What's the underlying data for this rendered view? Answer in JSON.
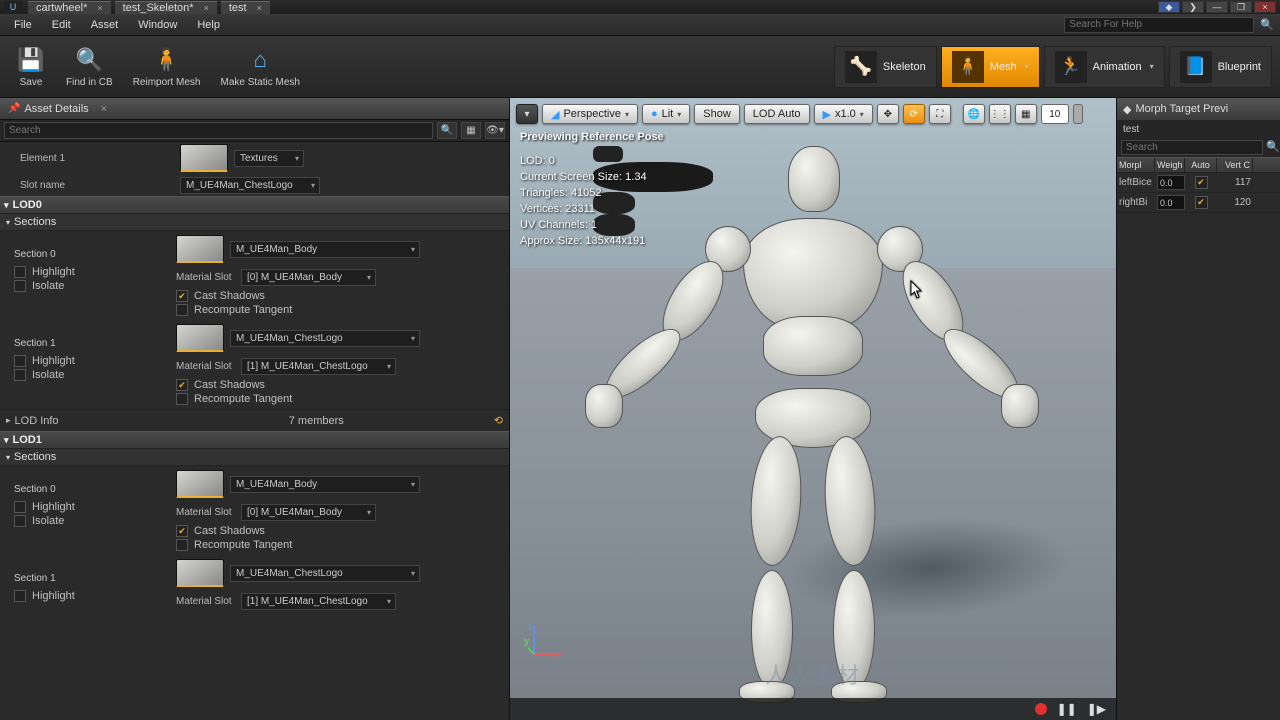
{
  "titlebar": {
    "tabs": [
      {
        "icon": "⬚",
        "label": "cartwheel*"
      },
      {
        "icon": "⬚",
        "label": "test_Skeleton*"
      },
      {
        "icon": "⬚",
        "label": "test"
      }
    ]
  },
  "menubar": {
    "items": [
      "File",
      "Edit",
      "Asset",
      "Window",
      "Help"
    ],
    "search_placeholder": "Search For Help"
  },
  "toolbar": {
    "left": [
      {
        "icon": "💾",
        "label": "Save"
      },
      {
        "icon": "🔍",
        "label": "Find in CB"
      },
      {
        "icon": "🧍",
        "label": "Reimport Mesh"
      },
      {
        "icon": "🏠",
        "label": "Make Static Mesh"
      }
    ],
    "modes": [
      {
        "icon": "🦴",
        "label": "Skeleton",
        "active": false
      },
      {
        "icon": "🧍",
        "label": "Mesh",
        "active": true,
        "caret": true
      },
      {
        "icon": "🏃",
        "label": "Animation",
        "active": false,
        "caret": true
      },
      {
        "icon": "📘",
        "label": "Blueprint",
        "active": false
      }
    ]
  },
  "left": {
    "title": "Asset Details",
    "search_placeholder": "Search",
    "element_label": "Element 1",
    "textures_label": "Textures",
    "slot_name_label": "Slot name",
    "slot_name_value": "M_UE4Man_ChestLogo",
    "lod0_label": "LOD0",
    "lod1_label": "LOD1",
    "sections_label": "Sections",
    "section0_label": "Section 0",
    "section1_label": "Section 1",
    "highlight_label": "Highlight",
    "isolate_label": "Isolate",
    "material_slot_label": "Material Slot",
    "cast_shadows_label": "Cast Shadows",
    "recompute_label": "Recompute Tangent",
    "lodinfo_label": "LOD Info",
    "members_label": "7 members",
    "mat_body": "M_UE4Man_Body",
    "mat_logo": "M_UE4Man_ChestLogo",
    "slot0": "[0] M_UE4Man_Body",
    "slot1": "[1] M_UE4Man_ChestLogo"
  },
  "viewport": {
    "perspective": "Perspective",
    "lit": "Lit",
    "show": "Show",
    "lod": "LOD Auto",
    "speed": "x1.0",
    "grid_num": "10",
    "overlay_title": "Previewing Reference Pose",
    "overlay_lines": [
      "LOD: 0",
      "Current Screen Size: 1.34",
      "Triangles: 41052",
      "Vertices: 23311",
      "UV Channels: 1",
      "Approx Size: 135x44x191"
    ],
    "watermark": "人人素材"
  },
  "right": {
    "title": "Morph Target Previ",
    "filter": "test",
    "search_placeholder": "Search",
    "headers": [
      "Morpl",
      "Weigh",
      "Auto",
      "Vert C"
    ],
    "rows": [
      {
        "name": "leftBice",
        "weight": "0.0",
        "auto": true,
        "verts": "117"
      },
      {
        "name": "rightBi",
        "weight": "0.0",
        "auto": true,
        "verts": "120"
      }
    ]
  }
}
